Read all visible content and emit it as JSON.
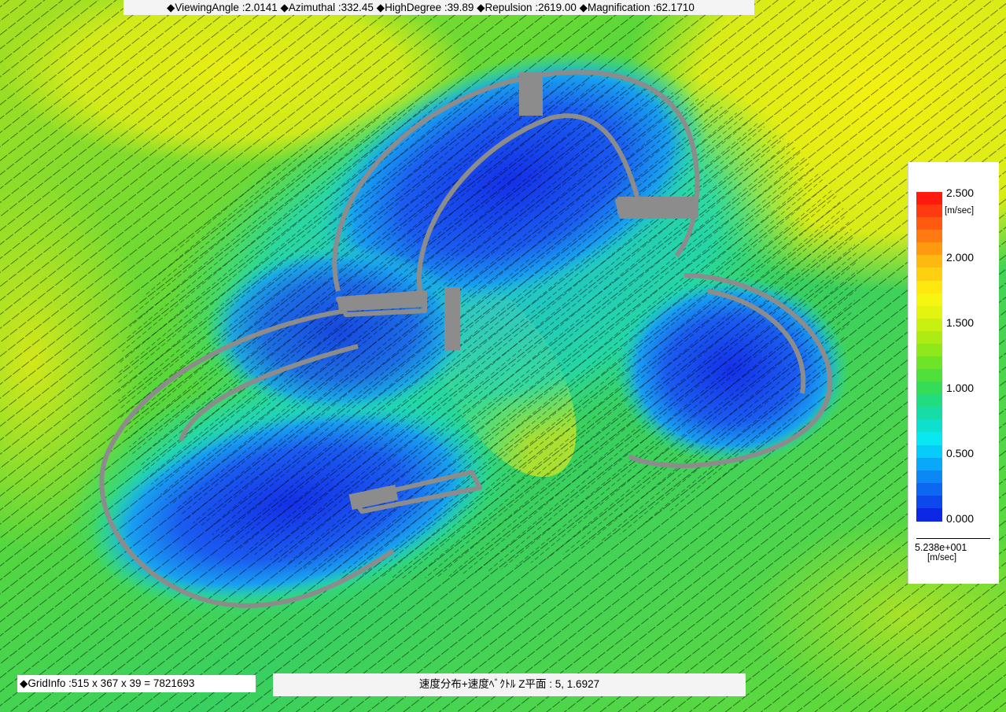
{
  "header": {
    "params_text": "◆ViewingAngle :2.0141  ◆Azimuthal :332.45 ◆HighDegree :39.89  ◆Repulsion :2619.00  ◆Magnification :62.1710"
  },
  "footer": {
    "grid_info": "◆GridInfo :515 x 367 x 39 = 7821693",
    "plane_label": "速度分布+速度ﾍﾞｸﾄﾙ Z平面 : 5,  1.6927"
  },
  "legend": {
    "max_label": "2.500",
    "unit_top": "[m/sec]",
    "ticks": [
      "2.000",
      "1.500",
      "1.000",
      "0.500",
      "0.000"
    ],
    "vector_scale_value": "5.238e+001",
    "vector_scale_unit": "[m/sec]",
    "colors": [
      "#ff1a10",
      "#ff3a10",
      "#ff5a10",
      "#ff7a10",
      "#ff9a10",
      "#ffb810",
      "#ffd010",
      "#ffe810",
      "#f6f610",
      "#e2f410",
      "#c8f010",
      "#acec14",
      "#8ee81c",
      "#6ee428",
      "#50e03c",
      "#34dc58",
      "#22dc80",
      "#16dca8",
      "#0ee0d0",
      "#08e8f0",
      "#08ccf8",
      "#0aa8f8",
      "#0c88f4",
      "#0c68f0",
      "#0c48ec",
      "#0c28e4"
    ]
  },
  "colors": {
    "slow": "#1a3cf0",
    "fast": "#f0f010",
    "building": "#8c8c8c"
  }
}
